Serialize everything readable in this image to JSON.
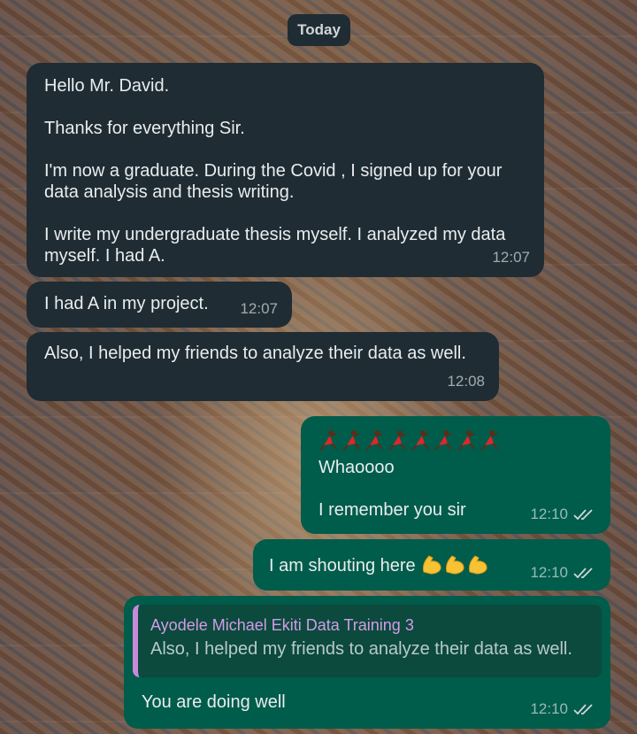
{
  "date_chip": "Today",
  "messages": [
    {
      "direction": "incoming",
      "paragraphs": [
        "Hello Mr. David.",
        "Thanks for everything Sir.",
        "I'm now a graduate. During the Covid , I signed up for your data analysis and thesis writing.",
        "I write my undergraduate thesis myself. I analyzed my data myself. I had A."
      ],
      "time": "12:07"
    },
    {
      "direction": "incoming",
      "text": "I had A in my project.",
      "time": "12:07"
    },
    {
      "direction": "incoming",
      "text": "Also, I helped my friends to analyze their data as well.",
      "time": "12:08"
    },
    {
      "direction": "outgoing",
      "emoji": "dancer-emoji",
      "emoji_count": 8,
      "paragraphs": [
        "Whaoooo",
        "I remember you sir"
      ],
      "time": "12:10",
      "status": "read"
    },
    {
      "direction": "outgoing",
      "text": "I am shouting here",
      "emoji": "flexed-biceps-emoji",
      "emoji_count": 3,
      "time": "12:10",
      "status": "read"
    },
    {
      "direction": "outgoing",
      "reply_to": {
        "author": "Ayodele Michael Ekiti Data Training 3",
        "text": "Also, I helped my friends to analyze their data as well."
      },
      "text": "You are doing well",
      "time": "12:10",
      "status": "read"
    }
  ],
  "colors": {
    "incoming_bubble": "#1f2c33",
    "outgoing_bubble": "#005c4b",
    "quote_author": "#d49be6",
    "read_check": "#d1d7db"
  }
}
